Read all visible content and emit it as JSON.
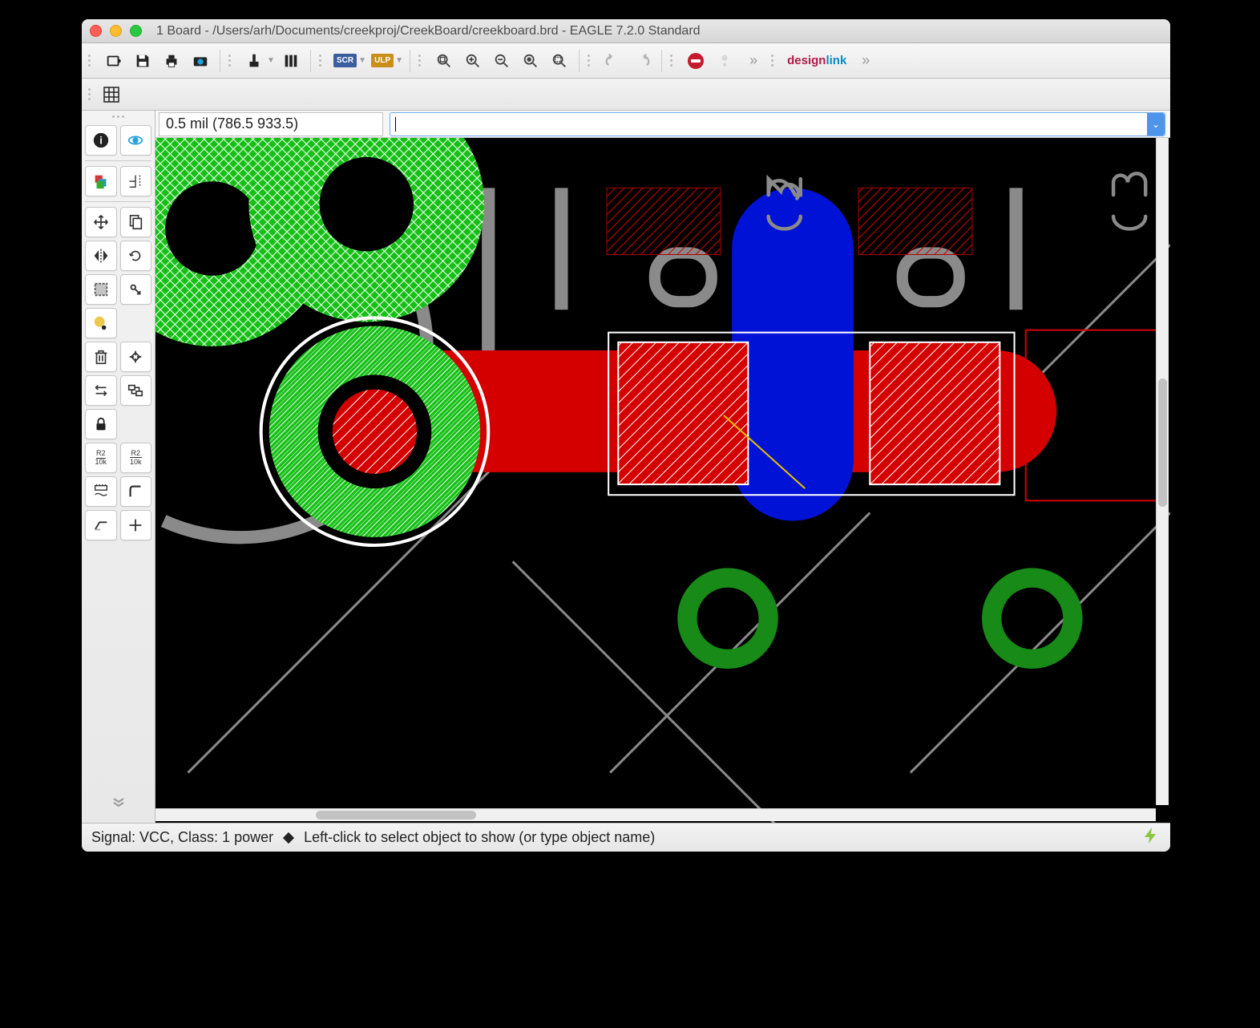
{
  "window": {
    "title": "1 Board - /Users/arh/Documents/creekproj/CreekBoard/creekboard.brd - EAGLE 7.2.0 Standard"
  },
  "toolbar": {
    "scr_label": "SCR",
    "ulp_label": "ULP",
    "designlink_1": "design",
    "designlink_2": "link"
  },
  "coord": {
    "text": "0.5 mil (786.5 933.5)"
  },
  "command": {
    "value": ""
  },
  "status": {
    "signal_label": "Signal: VCC, Class: 1 power",
    "hint": "Left-click to select object to show (or type object name)"
  },
  "canvas": {
    "component_labels": [
      "C2",
      "C3"
    ]
  }
}
